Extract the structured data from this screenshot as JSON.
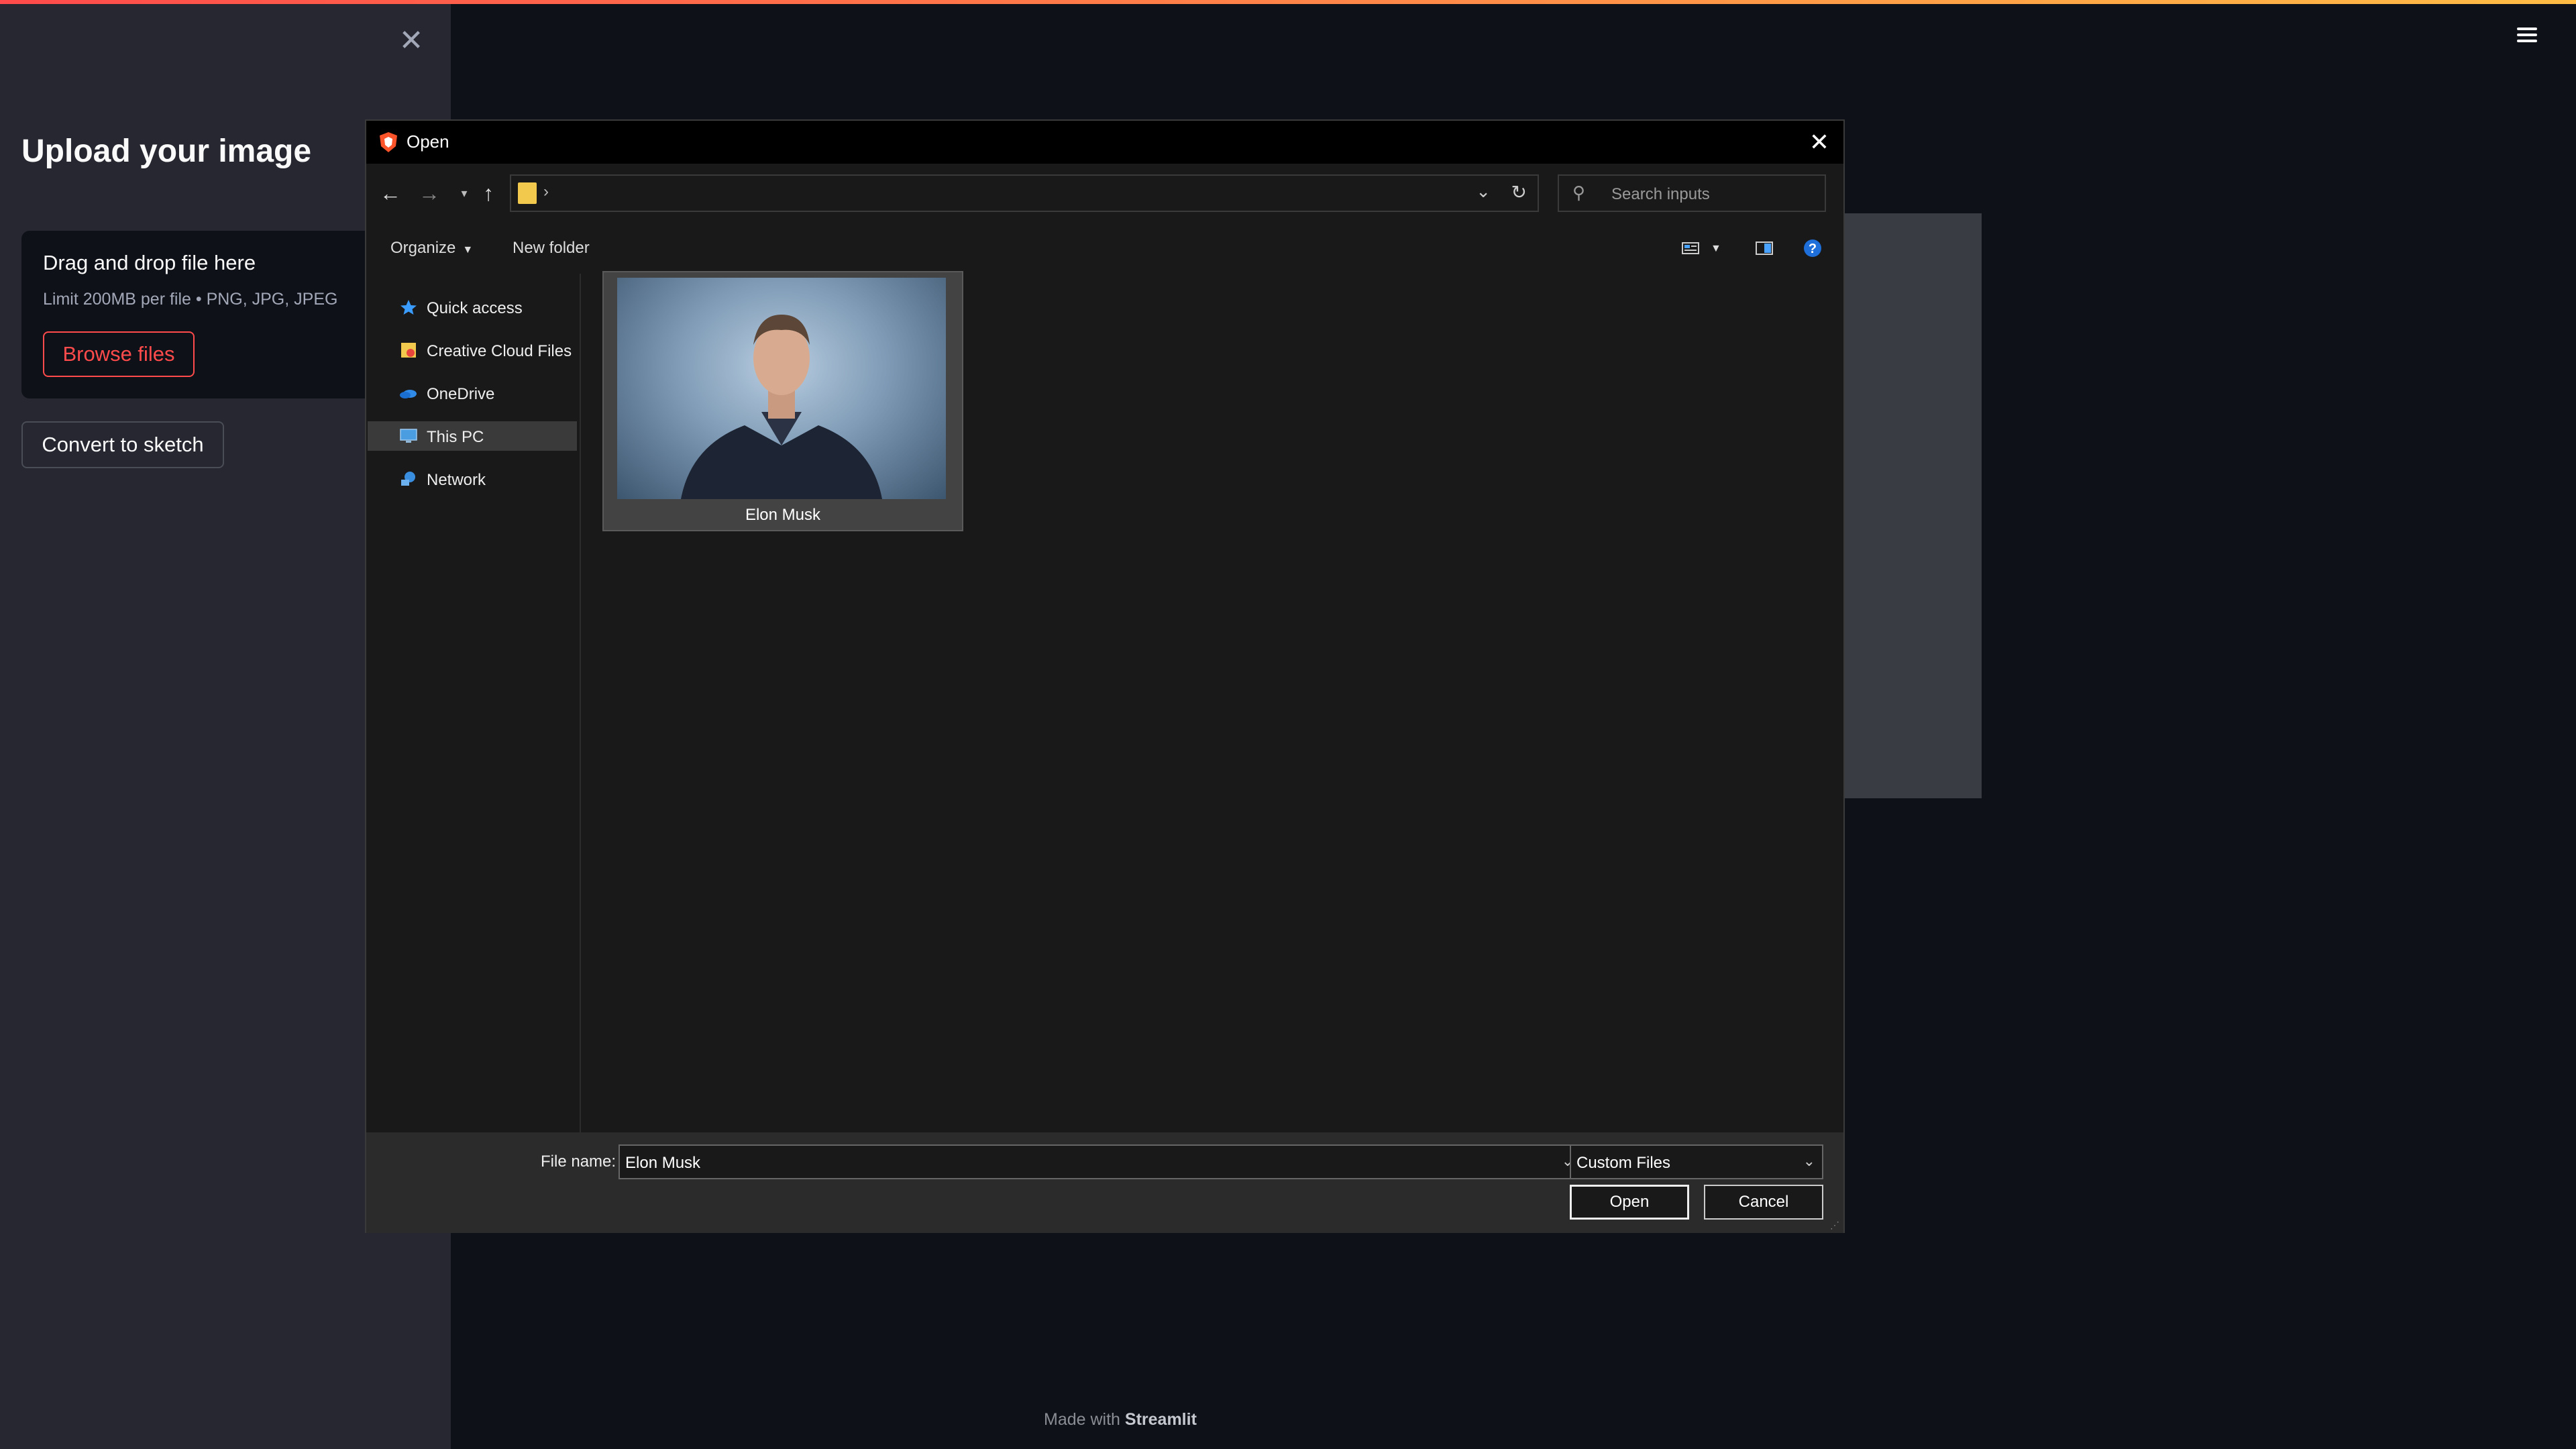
{
  "sidebar": {
    "title": "Upload your image",
    "uploader": {
      "title": "Drag and drop file here",
      "limit": "Limit 200MB per file • PNG, JPG, JPEG",
      "browse_label": "Browse files"
    },
    "convert_label": "Convert to sketch"
  },
  "footer": {
    "prefix": "Made with",
    "brand": "Streamlit"
  },
  "dialog": {
    "title": "Open",
    "search_placeholder": "Search inputs",
    "organize_label": "Organize",
    "new_folder_label": "New folder",
    "nav_items": [
      {
        "label": "Quick access",
        "icon": "star-icon"
      },
      {
        "label": "Creative Cloud Files",
        "icon": "creative-cloud-folder-icon"
      },
      {
        "label": "OneDrive",
        "icon": "cloud-icon"
      },
      {
        "label": "This PC",
        "icon": "computer-icon"
      },
      {
        "label": "Network",
        "icon": "network-icon"
      }
    ],
    "files": [
      {
        "name": "Elon Musk"
      }
    ],
    "file_name_label": "File name:",
    "file_name_value": "Elon Musk",
    "file_type_value": "Custom Files",
    "open_label": "Open",
    "cancel_label": "Cancel"
  },
  "colors": {
    "accent": "#ff4b4b",
    "sidebar_bg": "#262730",
    "app_bg": "#0e1117",
    "dialog_bg": "#191919"
  }
}
